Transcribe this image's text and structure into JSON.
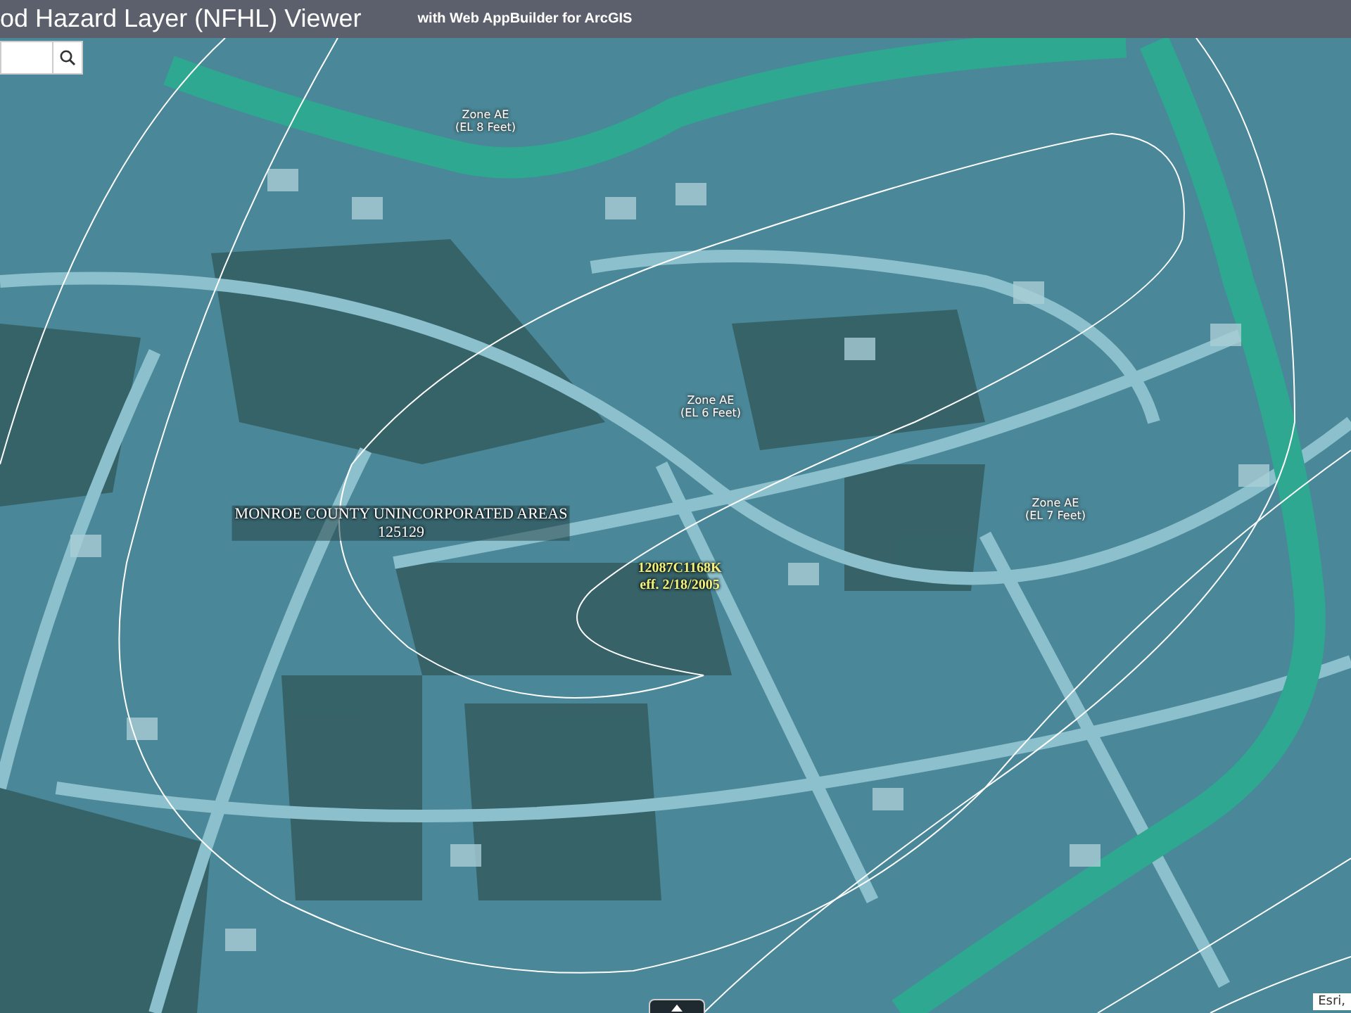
{
  "header": {
    "title": "od Hazard Layer (NFHL) Viewer",
    "subtitle": "with Web AppBuilder for ArcGIS"
  },
  "map": {
    "labels": [
      {
        "kind": "zone",
        "lines": [
          "Zone AE",
          "(EL 8 Feet)"
        ]
      },
      {
        "kind": "zone",
        "lines": [
          "Zone AE",
          "(EL 6 Feet)"
        ]
      },
      {
        "kind": "community",
        "lines": [
          "MONROE COUNTY UNINCORPORATED AREAS",
          "125129"
        ]
      },
      {
        "kind": "panel",
        "lines": [
          "12087C1168K",
          "eff. 2/18/2005"
        ]
      },
      {
        "kind": "zone",
        "lines": [
          "Zone AE",
          "(EL 7 Feet)"
        ]
      }
    ],
    "attribution": "Esri,"
  }
}
